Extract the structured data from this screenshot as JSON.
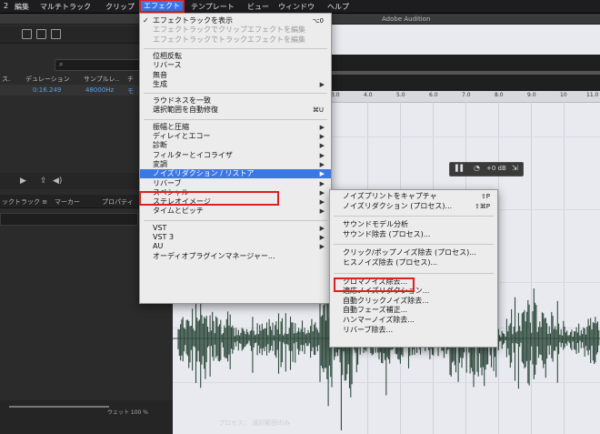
{
  "menubar": {
    "items": [
      "2",
      "編集",
      "マルチトラック",
      "クリップ",
      "エフェクト",
      "テンプレート",
      "ビュー",
      "ウィンドウ",
      "ヘルプ"
    ]
  },
  "window": {
    "title": "Adobe Audition"
  },
  "files_panel": {
    "search_placeholder": "",
    "headers": [
      "ス.",
      "デュレーション",
      "サンプルレ..",
      "チ"
    ],
    "row": {
      "duration": "0:16.249",
      "sample_rate": "48000Hz",
      "extra": "モ"
    }
  },
  "tabs": {
    "track": "ックトラック ≡",
    "marker": "マーカー",
    "props": "プロパティ"
  },
  "effects_menu": {
    "items": [
      {
        "label": "エフェクトラックを表示",
        "shortcut": "⌥0",
        "checked": true,
        "disabled": false
      },
      {
        "label": "エフェクトラックでクリップエフェクトを編集",
        "disabled": true
      },
      {
        "label": "エフェクトラックでトラックエフェクトを編集",
        "disabled": true
      },
      {
        "sep": true
      },
      {
        "label": "位相反転",
        "disabled": false
      },
      {
        "label": "リバース",
        "disabled": false
      },
      {
        "label": "無音",
        "disabled": false
      },
      {
        "label": "生成",
        "submenu": true
      },
      {
        "sep": true
      },
      {
        "label": "ラウドネスを一致",
        "disabled": false
      },
      {
        "label": "選択範囲を自動修復",
        "shortcut": "⌘U"
      },
      {
        "sep": true
      },
      {
        "label": "振幅と圧縮",
        "submenu": true
      },
      {
        "label": "ディレイとエコー",
        "submenu": true
      },
      {
        "label": "診断",
        "submenu": true
      },
      {
        "label": "フィルターとイコライザ",
        "submenu": true
      },
      {
        "label": "変調",
        "submenu": true
      },
      {
        "label": "ノイズリダクション / リストア",
        "submenu": true,
        "highlight": true
      },
      {
        "label": "リバーブ",
        "submenu": true
      },
      {
        "label": "スペシャル",
        "submenu": true
      },
      {
        "label": "ステレオイメージ",
        "submenu": true
      },
      {
        "label": "タイムとピッチ",
        "submenu": true
      },
      {
        "sep": true
      },
      {
        "label": "VST",
        "submenu": true
      },
      {
        "label": "VST 3",
        "submenu": true
      },
      {
        "label": "AU",
        "submenu": true
      },
      {
        "label": "オーディオプラグインマネージャー...",
        "disabled": false
      }
    ]
  },
  "noise_submenu": {
    "items": [
      {
        "label": "ノイズプリントをキャプチャ",
        "shortcut": "⇧P"
      },
      {
        "label": "ノイズリダクション (プロセス)...",
        "shortcut": "⇧⌘P"
      },
      {
        "sep": true
      },
      {
        "label": "サウンドモデル分析"
      },
      {
        "label": "サウンド除去 (プロセス)..."
      },
      {
        "sep": true
      },
      {
        "label": "クリック/ポップノイズ除去 (プロセス)..."
      },
      {
        "label": "ヒスノイズ除去 (プロセス)..."
      },
      {
        "sep": true
      },
      {
        "label": "クロマノイズ除去...",
        "boxed": true
      },
      {
        "label": "適応ノイズリダクション..."
      },
      {
        "label": "自動クリックノイズ除去..."
      },
      {
        "label": "自動フェーズ補正..."
      },
      {
        "label": "ハンマーノイズ除去..."
      },
      {
        "label": "リバーブ除去..."
      }
    ]
  },
  "ruler": {
    "ticks": [
      "3.0",
      "4.0",
      "5.0",
      "6.0",
      "7.0",
      "8.0",
      "9.0",
      "10",
      "11.0"
    ]
  },
  "hud": {
    "db": "+0 dB"
  },
  "status": {
    "text": "プロセス：  選択範囲のみ"
  },
  "bottom": {
    "label": "ウェット 100 %"
  },
  "colors": {
    "accent": "#3c77e6",
    "redbox": "#e02020",
    "waveform": "#2e4a3c",
    "editor_bg": "#e9eaf0"
  }
}
